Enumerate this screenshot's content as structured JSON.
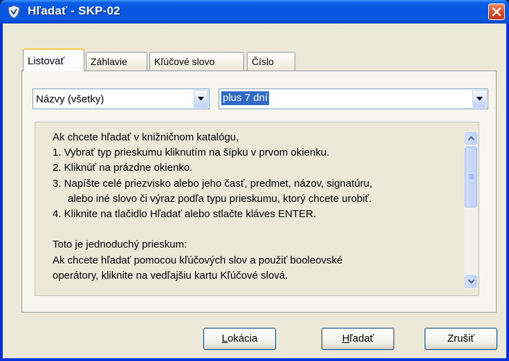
{
  "window": {
    "title": "Hľadať - SKP-02",
    "icon": "shield-icon",
    "close_icon": "close-icon"
  },
  "tabs": [
    {
      "label": "Listovať",
      "active": true
    },
    {
      "label": "Záhlavie",
      "active": false
    },
    {
      "label": "Kľúčové slovo",
      "active": false
    },
    {
      "label": "Číslo",
      "active": false
    }
  ],
  "search_type": {
    "selected": "Názvy (všetky)"
  },
  "search_value": {
    "selected": "plus 7 dní"
  },
  "instructions": {
    "lines": [
      "Ak chcete hľadať v knižničnom katalógu,",
      "1.  Vybrať typ prieskumu kliknutím na šípku v prvom okienku.",
      "2.  Kliknúť na prázdne okienko.",
      "3.  Napíšte celé priezvisko alebo jeho časť, predmet, názov, signatúru,",
      "alebo iné slovo či výraz podľa typu prieskumu, ktorý chcete urobiť.",
      "4.  Kliknite na tlačidlo Hľadať alebo stlačte kláves ENTER.",
      "",
      "Toto je jednoduchý prieskum:",
      "Ak chcete hľadať pomocou kľúčových slov a použiť booleovské",
      "operátory, kliknite na vedľajšiu kartu Kľúčové slová."
    ]
  },
  "buttons": {
    "location": {
      "underline": "L",
      "rest": "okácia"
    },
    "search": {
      "underline": "H",
      "rest": "ľadať"
    },
    "cancel": {
      "label": "Zrušiť"
    }
  },
  "colors": {
    "title_bar": "#0653e0",
    "selection": "#316ac5",
    "active_tab_accent": "#ffc83c",
    "close_button": "#d8471f"
  }
}
